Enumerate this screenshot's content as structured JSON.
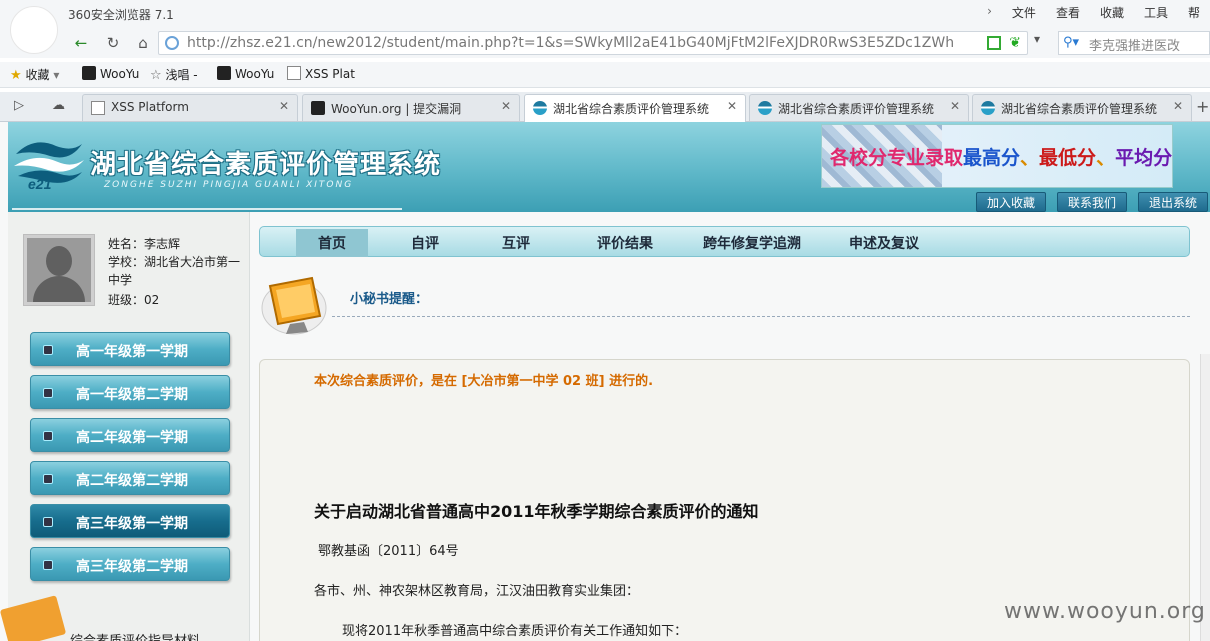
{
  "browser": {
    "app_title": "360安全浏览器 7.1",
    "menu": [
      "文件",
      "查看",
      "收藏",
      "工具",
      "帮"
    ],
    "url": "http://zhsz.e21.cn/new2012/student/main.php?t=1&s=SWkyMll2aE41bG40MjFtM2lFeXJDR0RwS3E5ZDc1ZWh",
    "search_placeholder": "李克强推进医改",
    "favorites": [
      "收藏",
      "WooYu",
      "浅唱 -",
      "WooYu",
      "XSS Plat"
    ],
    "tabs": [
      {
        "title": "XSS Platform",
        "active": false
      },
      {
        "title": "WooYun.org | 提交漏洞",
        "active": false
      },
      {
        "title": "湖北省综合素质评价管理系统",
        "active": true
      },
      {
        "title": "湖北省综合素质评价管理系统",
        "active": false
      },
      {
        "title": "湖北省综合素质评价管理系统",
        "active": false
      }
    ]
  },
  "header": {
    "logo_text": "e21",
    "title": "湖北省综合素质评价管理系统",
    "subtitle": "ZONGHE SUZHI PINGJIA GUANLI XITONG",
    "ad": {
      "p1": "各校分专业录取",
      "p2": "最高分",
      "p3": "、",
      "p4": "最低分",
      "p5": "、",
      "p6": "平均分"
    },
    "buttons": [
      "加入收藏",
      "联系我们",
      "退出系统"
    ]
  },
  "student": {
    "name": "姓名：李志辉",
    "school_line1": "学校：湖北省大冶市第一",
    "school_line2": "中学",
    "class": "班级：02"
  },
  "semesters": [
    {
      "label": "高一年级第一学期",
      "active": false
    },
    {
      "label": "高一年级第二学期",
      "active": false
    },
    {
      "label": "高二年级第一学期",
      "active": false
    },
    {
      "label": "高二年级第二学期",
      "active": false
    },
    {
      "label": "高三年级第一学期",
      "active": true
    },
    {
      "label": "高三年级第二学期",
      "active": false
    }
  ],
  "guide_label": "综合素质评价指导材料",
  "nav": [
    "首页",
    "自评",
    "互评",
    "评价结果",
    "跨年修复学追溯",
    "申述及复议"
  ],
  "secretary_label": "小秘书提醒：",
  "main": {
    "eval_note": "本次综合素质评价，是在 [大冶市第一中学 02 班] 进行的.",
    "notice_title": "关于启动湖北省普通高中2011年秋季学期综合素质评价的通知",
    "doc_no": "鄂教基函〔2011〕64号",
    "salutation": "各市、州、神农架林区教育局，江汉油田教育实业集团：",
    "body_line": "现将2011年秋季普通高中综合素质评价有关工作通知如下："
  },
  "watermark": "www.wooyun.org"
}
